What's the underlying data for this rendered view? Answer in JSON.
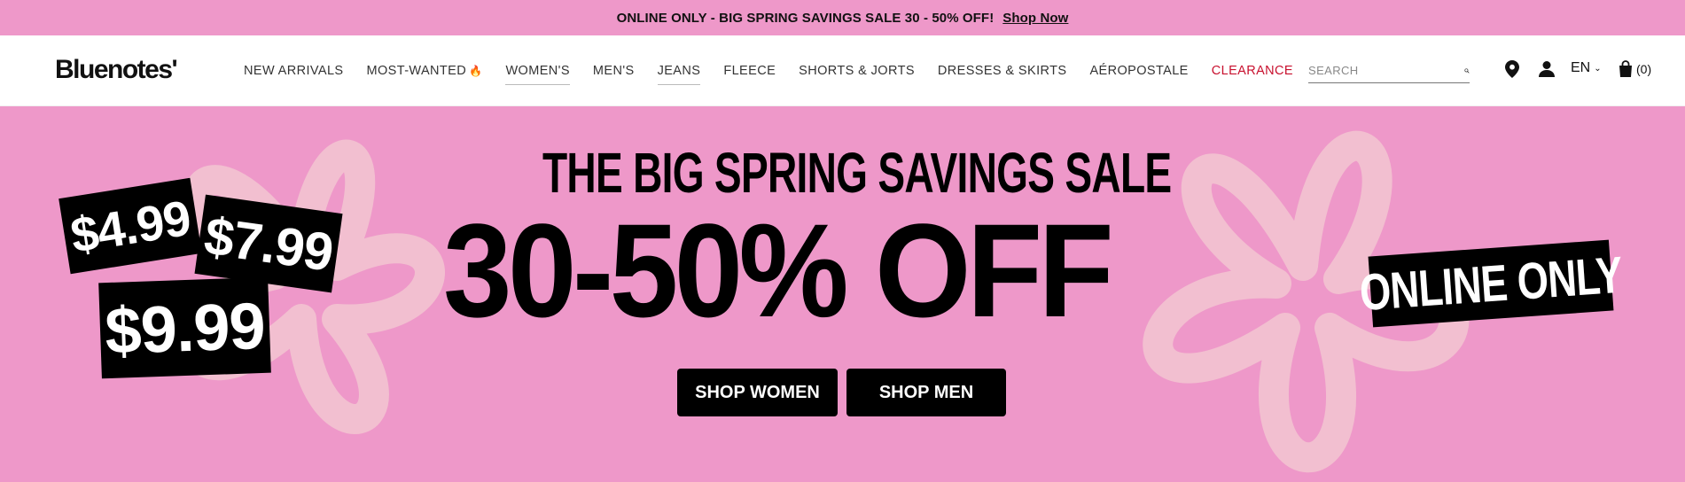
{
  "promo": {
    "text": "ONLINE ONLY - BIG SPRING SAVINGS SALE 30 - 50% OFF!",
    "link": "Shop Now"
  },
  "header": {
    "logo": "Bluenotes'",
    "nav": [
      {
        "label": "NEW ARRIVALS"
      },
      {
        "label": "MOST-WANTED"
      },
      {
        "label": "WOMEN'S"
      },
      {
        "label": "MEN'S"
      },
      {
        "label": "JEANS"
      },
      {
        "label": "FLEECE"
      },
      {
        "label": "SHORTS & JORTS"
      },
      {
        "label": "DRESSES & SKIRTS"
      },
      {
        "label": "AÉROPOSTALE"
      },
      {
        "label": "CLEARANCE"
      }
    ],
    "search": {
      "placeholder": "SEARCH"
    },
    "language": "EN",
    "cart": "(0)"
  },
  "hero": {
    "tags": [
      "$4.99",
      "$7.99",
      "$9.99"
    ],
    "subtitle": "THE BIG SPRING SAVINGS SALE",
    "title": "30-50% OFF",
    "online_only": "ONLINE ONLY",
    "buttons": {
      "women": "SHOP WOMEN",
      "men": "SHOP MEN"
    }
  },
  "colors": {
    "pink": "#ee98c9",
    "flower": "#f2bfd0",
    "clearance": "#c8102e"
  }
}
